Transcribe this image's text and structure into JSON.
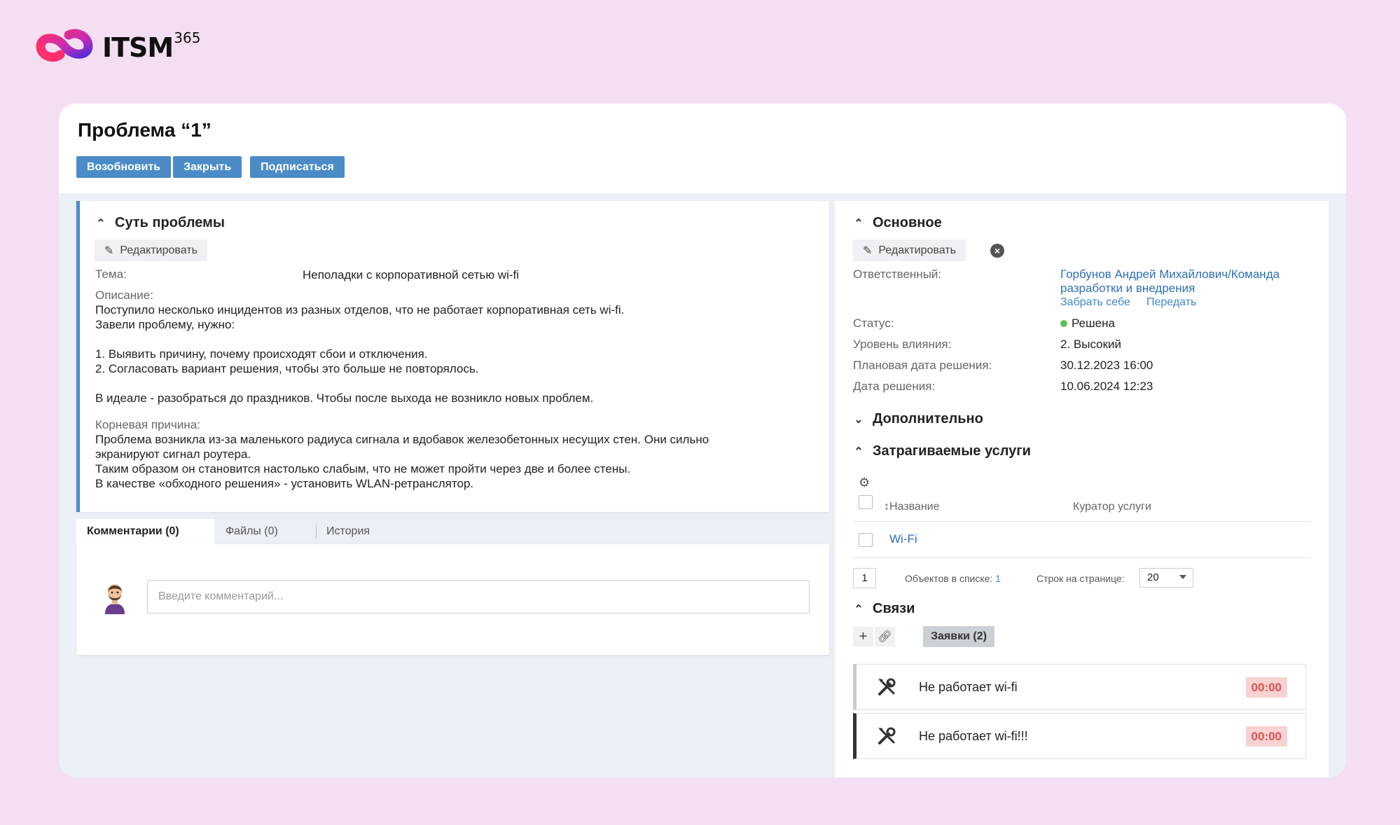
{
  "brand": {
    "name": "ITSM",
    "sup": "365"
  },
  "header": {
    "title": "Проблема “1”",
    "actions": [
      "Возобновить",
      "Закрыть",
      "Подписаться"
    ]
  },
  "essence": {
    "section_title": "Суть проблемы",
    "edit_label": "Редактировать",
    "topic_label": "Тема:",
    "topic_value": "Неполадки с корпоративной сетью wi-fi",
    "description_label": "Описание:",
    "description_lines": [
      "Поступило несколько инцидентов из разных отделов, что не работает корпоративная сеть wi-fi.",
      "Завели проблему, нужно:",
      "",
      "1. Выявить причину, почему происходят сбои и отключения.",
      "2. Согласовать вариант решения, чтобы это больше не повторялось.",
      "",
      "В идеале - разобраться до праздников. Чтобы после выхода не возникло новых проблем."
    ],
    "root_cause_label": "Корневая причина:",
    "root_cause_lines": [
      "Проблема возникла из-за маленького радиуса сигнала и вдобавок железобетонных несущих стен. Они сильно",
      "экранируют сигнал роутера.",
      "Таким образом он становится настолько слабым, что не может пройти через две и более стены.",
      "В качестве «обходного решения» - установить WLAN-ретранслятор."
    ]
  },
  "tabs": [
    {
      "label": "Комментарии (0)",
      "active": true
    },
    {
      "label": "Файлы (0)",
      "active": false
    },
    {
      "label": "История",
      "active": false
    }
  ],
  "comment": {
    "placeholder": "Введите комментарий..."
  },
  "main_info": {
    "section_title": "Основное",
    "edit_label": "Редактировать",
    "responsible_label": "Ответственный:",
    "responsible_value_line1": "Горбунов Андрей Михайлович/Команда",
    "responsible_value_line2": "разработки и внедрения",
    "take_label": "Забрать себе",
    "transfer_label": "Передать",
    "status_label": "Статус:",
    "status_value": "Решена",
    "status_color": "#5bc25b",
    "impact_label": "Уровень влияния:",
    "impact_value": "2. Высокий",
    "planned_label": "Плановая дата решения:",
    "planned_value": "30.12.2023 16:00",
    "resolved_label": "Дата решения:",
    "resolved_value": "10.06.2024 12:23"
  },
  "additional": {
    "section_title": "Дополнительно"
  },
  "services": {
    "section_title": "Затрагиваемые услуги",
    "columns": [
      "Название",
      "Куратор услуги"
    ],
    "rows": [
      {
        "name": "Wi-Fi",
        "curator": ""
      }
    ],
    "page": "1",
    "objects_label": "Объектов в списке:",
    "objects_count": "1",
    "per_page_label": "Строк на странице:",
    "per_page_value": "20"
  },
  "relations": {
    "section_title": "Связи",
    "chip_label": "Заявки (2)",
    "tickets": [
      {
        "title": "Не работает wi-fi",
        "timer": "00:00",
        "selected": false
      },
      {
        "title": "Не работает wi-fi!!!",
        "timer": "00:00",
        "selected": true
      }
    ]
  },
  "colors": {
    "background": "#f4dff2",
    "accent": "#4b8cc8",
    "timer_bg": "#f8d2d2",
    "timer_text": "#d9534f"
  }
}
